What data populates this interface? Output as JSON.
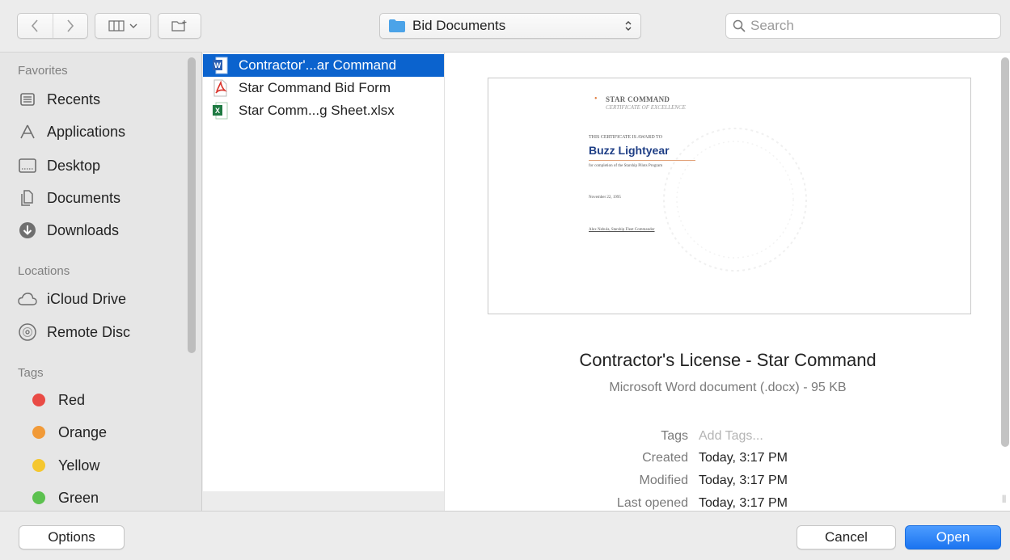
{
  "toolbar": {
    "location": "Bid Documents",
    "search_placeholder": "Search"
  },
  "sidebar": {
    "favorites_header": "Favorites",
    "favorites": [
      {
        "label": "Recents",
        "icon": "recents-icon"
      },
      {
        "label": "Applications",
        "icon": "applications-icon"
      },
      {
        "label": "Desktop",
        "icon": "desktop-icon"
      },
      {
        "label": "Documents",
        "icon": "documents-icon"
      },
      {
        "label": "Downloads",
        "icon": "downloads-icon"
      }
    ],
    "locations_header": "Locations",
    "locations": [
      {
        "label": "iCloud Drive",
        "icon": "icloud-icon"
      },
      {
        "label": "Remote Disc",
        "icon": "disc-icon"
      }
    ],
    "tags_header": "Tags",
    "tags": [
      {
        "label": "Red",
        "color": "#e94b45"
      },
      {
        "label": "Orange",
        "color": "#f19a38"
      },
      {
        "label": "Yellow",
        "color": "#f5c72f"
      },
      {
        "label": "Green",
        "color": "#5cc14f"
      }
    ]
  },
  "files": [
    {
      "name": "Contractor'...ar Command",
      "icon": "word-doc-icon",
      "selected": true
    },
    {
      "name": "Star Command Bid Form",
      "icon": "pdf-icon",
      "selected": false
    },
    {
      "name": "Star Comm...g Sheet.xlsx",
      "icon": "excel-icon",
      "selected": false
    }
  ],
  "preview": {
    "thumbnail": {
      "org": "STAR COMMAND",
      "cert_title": "CERTIFICATE OF EXCELLENCE",
      "award_line": "THIS CERTIFICATE IS AWARD TO",
      "recipient": "Buzz Lightyear",
      "completion": "for completion of the Starship Pilots Program",
      "date": "November 22, 1995",
      "signer": "Alex Nebula, Starship Fleet Commander"
    },
    "title": "Contractor's License - Star Command",
    "subtitle": "Microsoft Word document (.docx) - 95 KB",
    "meta": {
      "tags_label": "Tags",
      "tags_value": "Add Tags...",
      "created_label": "Created",
      "created_value": "Today, 3:17 PM",
      "modified_label": "Modified",
      "modified_value": "Today, 3:17 PM",
      "opened_label": "Last opened",
      "opened_value": "Today, 3:17 PM"
    }
  },
  "buttons": {
    "options": "Options",
    "cancel": "Cancel",
    "open": "Open"
  },
  "colors": {
    "accent": "#0b63ce",
    "open_button": "#1b74f0",
    "folder": "#4ba3e8"
  }
}
